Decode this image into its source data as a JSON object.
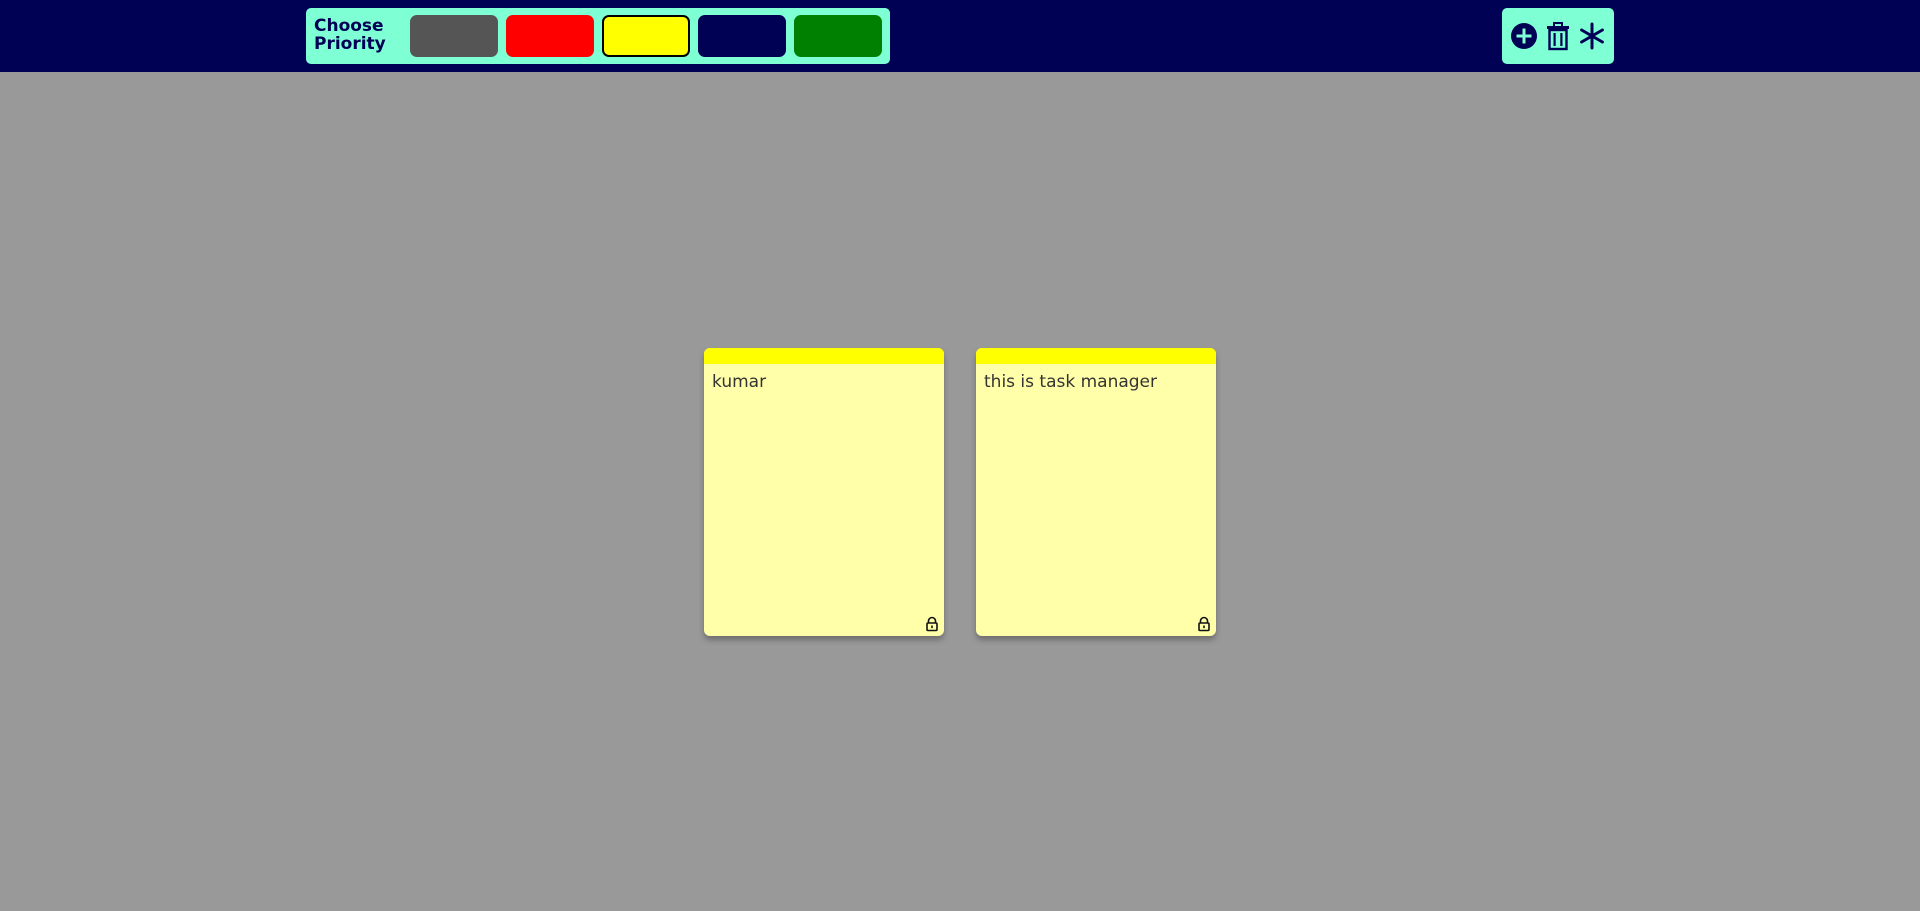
{
  "toolbar": {
    "priority_label": "Choose Priority",
    "swatches": [
      {
        "name": "gray",
        "color": "#555555",
        "selected": false
      },
      {
        "name": "red",
        "color": "#ff0000",
        "selected": false
      },
      {
        "name": "yellow",
        "color": "#ffff00",
        "selected": true
      },
      {
        "name": "navy",
        "color": "#000054",
        "selected": false
      },
      {
        "name": "green",
        "color": "#008000",
        "selected": false
      }
    ]
  },
  "actions": {
    "icons": [
      "add-circle-icon",
      "trash-icon",
      "asterisk-icon"
    ]
  },
  "tickets": [
    {
      "text": "kumar",
      "priority_color": "#ffff00",
      "locked": true,
      "lock_icon": "lock-icon"
    },
    {
      "text": "this is task manager",
      "priority_color": "#ffff00",
      "locked": true,
      "lock_icon": "lock-icon"
    }
  ],
  "colors": {
    "navbar": "#000054",
    "panel": "#7fffd4",
    "background": "#999999",
    "ticket_body": "#ffffaa"
  }
}
